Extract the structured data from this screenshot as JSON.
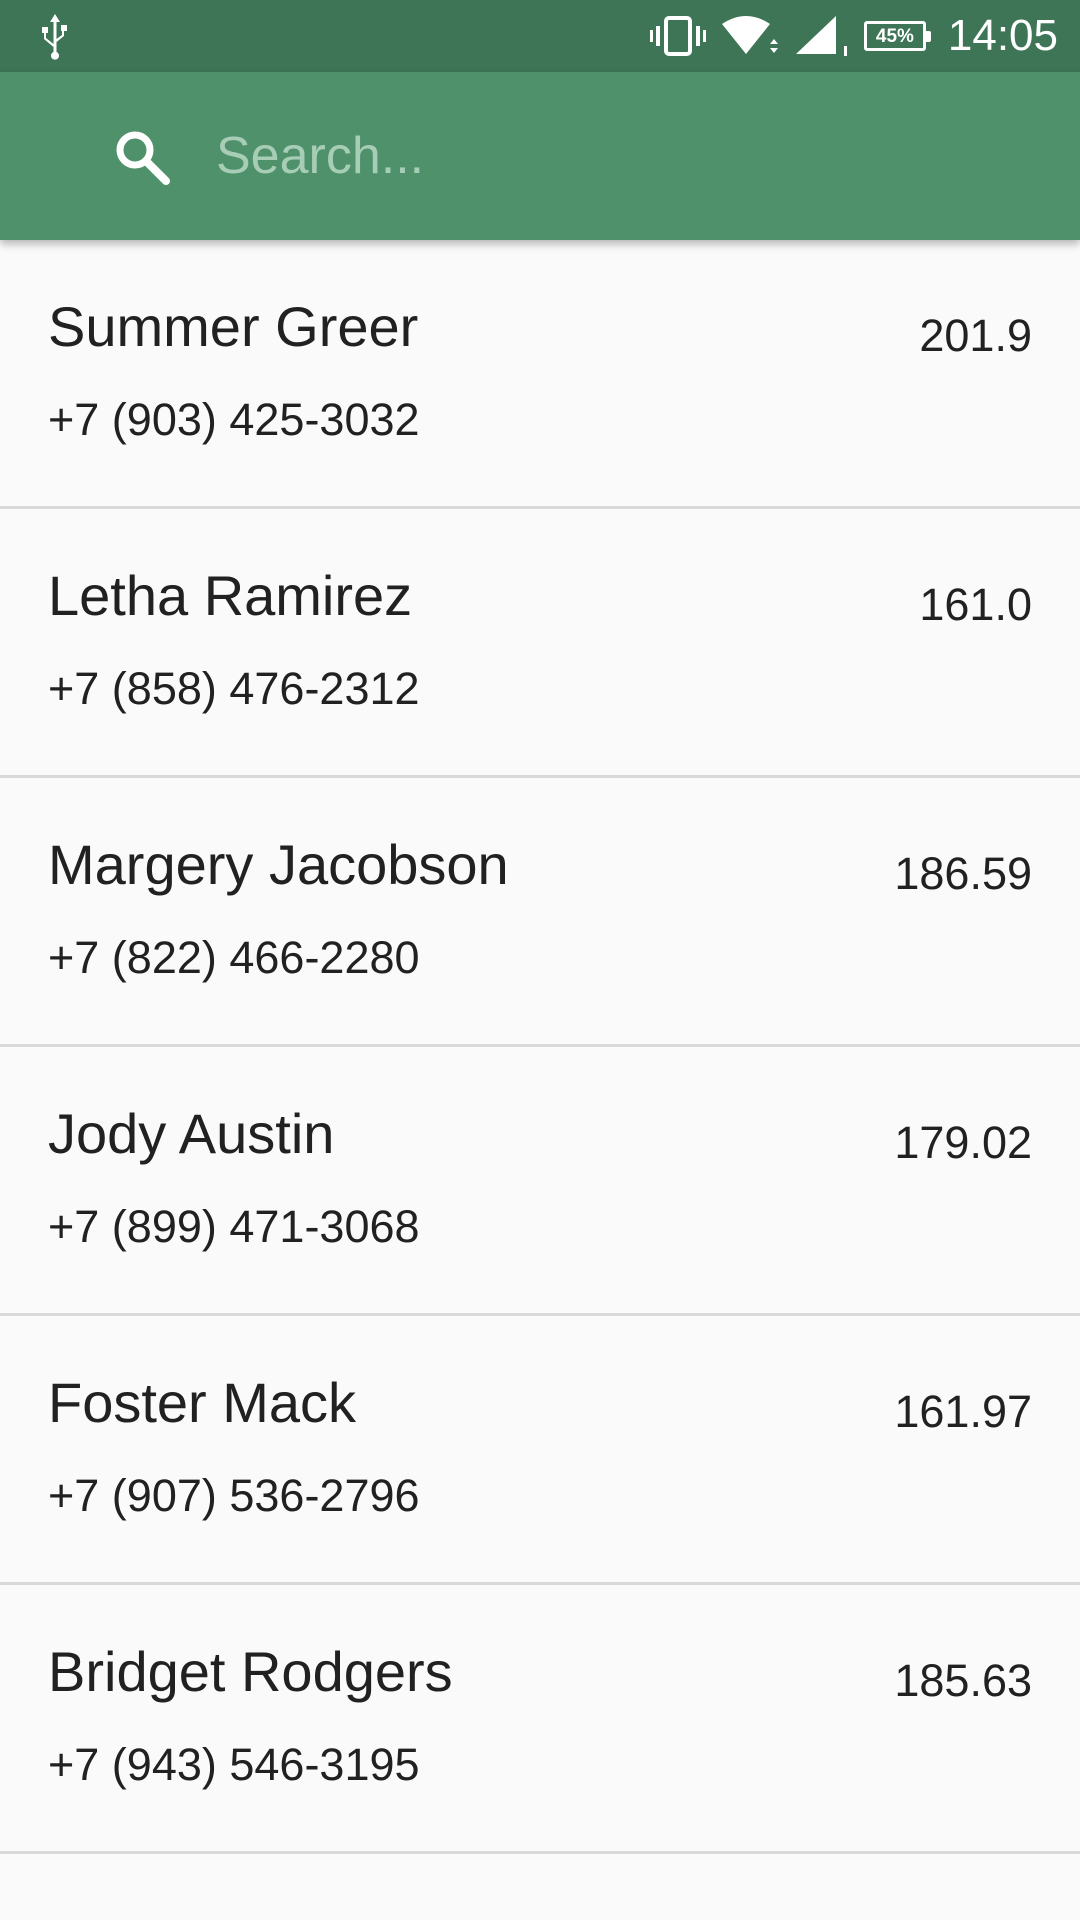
{
  "status_bar": {
    "time": "14:05",
    "battery": "45%",
    "icons": [
      "usb-icon",
      "vibrate-icon",
      "wifi-icon",
      "signal-icon",
      "battery-icon"
    ]
  },
  "search": {
    "placeholder": "Search...",
    "value": "",
    "icon": "search-icon"
  },
  "colors": {
    "status_bar": "#3e7556",
    "app_bar": "#4e916a",
    "background": "#fafafa",
    "divider": "#d9d9d9"
  },
  "contacts": [
    {
      "name": "Summer Greer",
      "phone": "+7 (903) 425-3032",
      "value": "201.9"
    },
    {
      "name": "Letha Ramirez",
      "phone": "+7 (858) 476-2312",
      "value": "161.0"
    },
    {
      "name": "Margery Jacobson",
      "phone": "+7 (822) 466-2280",
      "value": "186.59"
    },
    {
      "name": "Jody Austin",
      "phone": "+7 (899) 471-3068",
      "value": "179.02"
    },
    {
      "name": "Foster Mack",
      "phone": "+7 (907) 536-2796",
      "value": "161.97"
    },
    {
      "name": "Bridget Rodgers",
      "phone": "+7 (943) 546-3195",
      "value": "185.63"
    }
  ]
}
